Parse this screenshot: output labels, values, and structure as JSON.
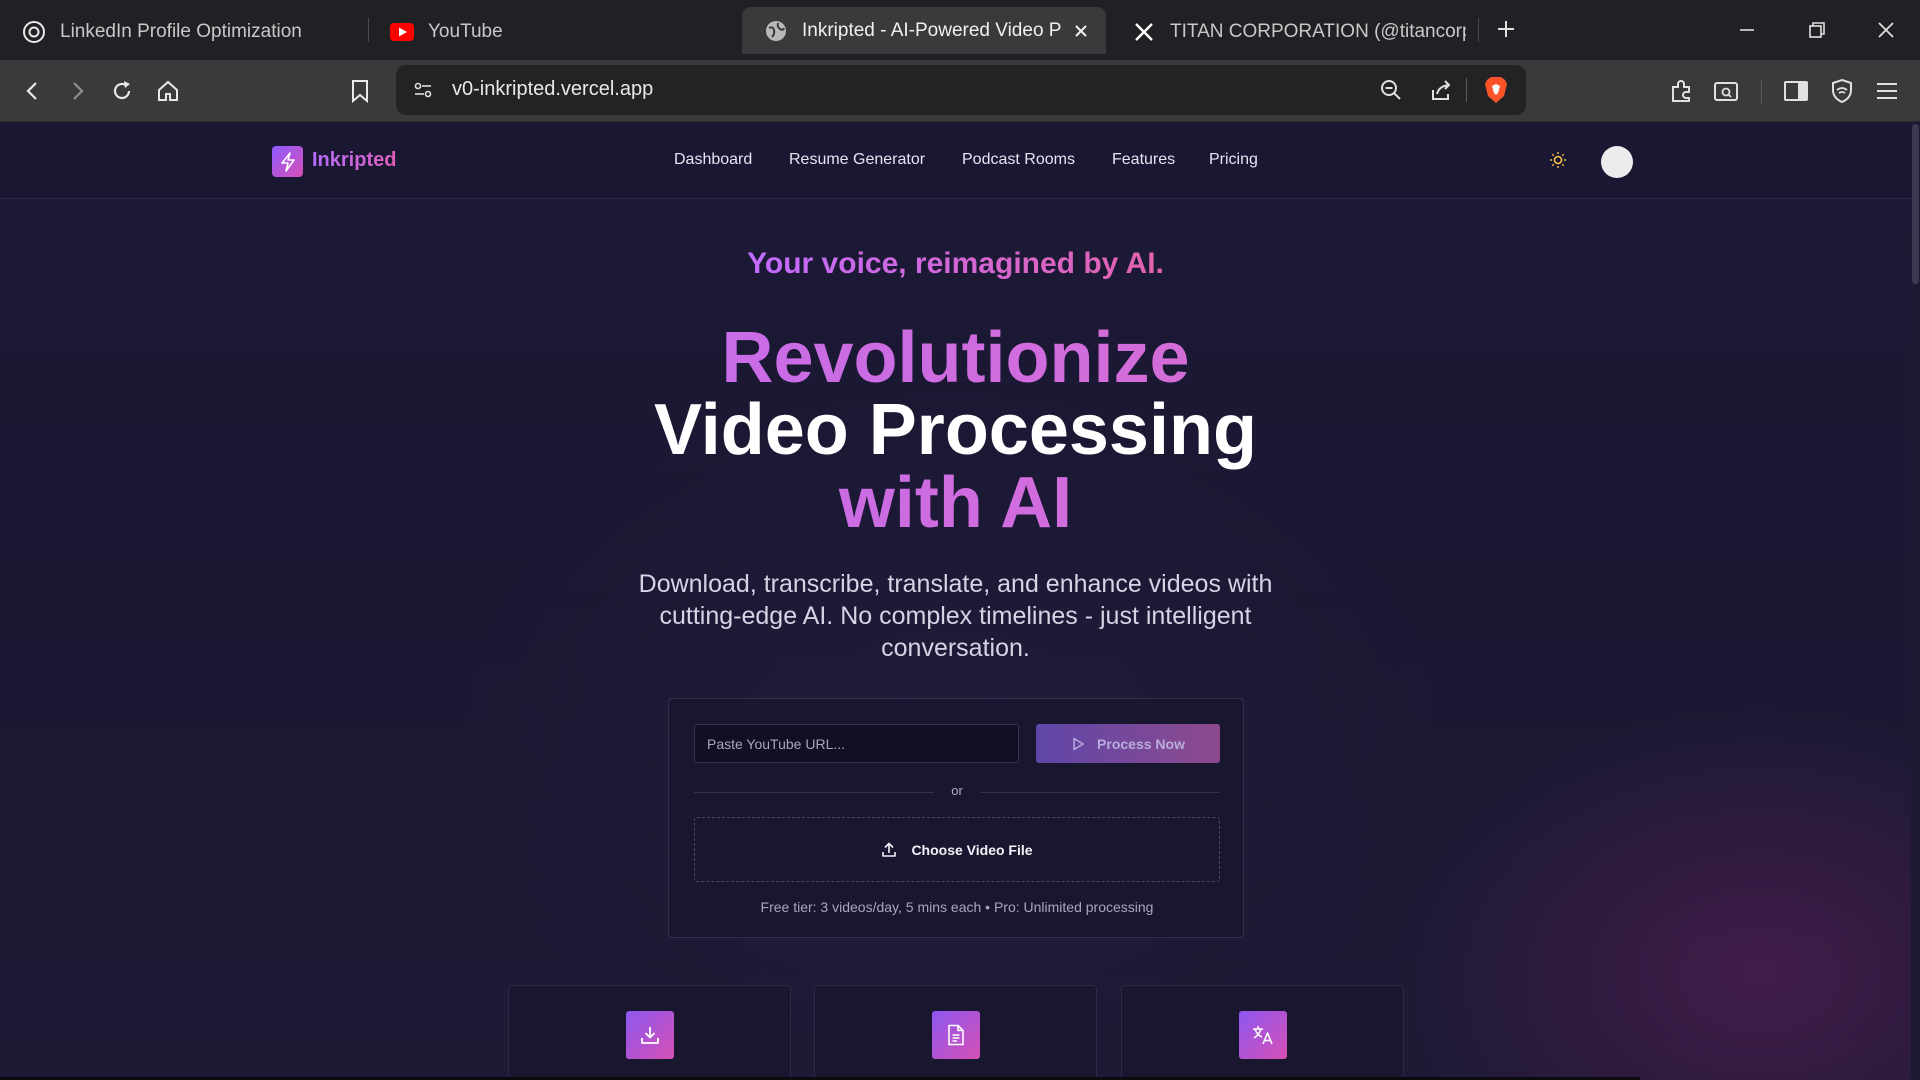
{
  "browser": {
    "tabs": [
      {
        "title": "LinkedIn Profile Optimization",
        "icon": "openai-icon"
      },
      {
        "title": "YouTube",
        "icon": "youtube-icon"
      },
      {
        "title": "Inkripted - AI-Powered Video Pro",
        "icon": "globe-icon",
        "active": true
      },
      {
        "title": "TITAN CORPORATION (@titancorpng",
        "icon": "x-logo-icon"
      }
    ],
    "url": "v0-inkripted.vercel.app"
  },
  "site": {
    "brand": "Inkripted",
    "nav": [
      "Dashboard",
      "Resume Generator",
      "Podcast Rooms",
      "Features",
      "Pricing"
    ]
  },
  "hero": {
    "tagline": "Your voice, reimagined by AI.",
    "title_line1": "Revolutionize",
    "title_line2": "Video Processing",
    "title_line3": "with AI",
    "subtitle": "Download, transcribe, translate, and enhance videos with cutting-edge AI. No complex timelines - just intelligent conversation."
  },
  "upload": {
    "url_placeholder": "Paste YouTube URL...",
    "process_label": "Process Now",
    "or_label": "or",
    "choose_label": "Choose Video File",
    "tier_note": "Free tier: 3 videos/day, 5 mins each • Pro: Unlimited processing"
  },
  "features": [
    {
      "icon": "download-icon"
    },
    {
      "icon": "document-icon"
    },
    {
      "icon": "translate-icon"
    }
  ],
  "colors": {
    "accent_purple": "#b56dff",
    "accent_pink": "#e05fb8",
    "page_bg": "#1c1936",
    "browser_frame": "#202124"
  }
}
